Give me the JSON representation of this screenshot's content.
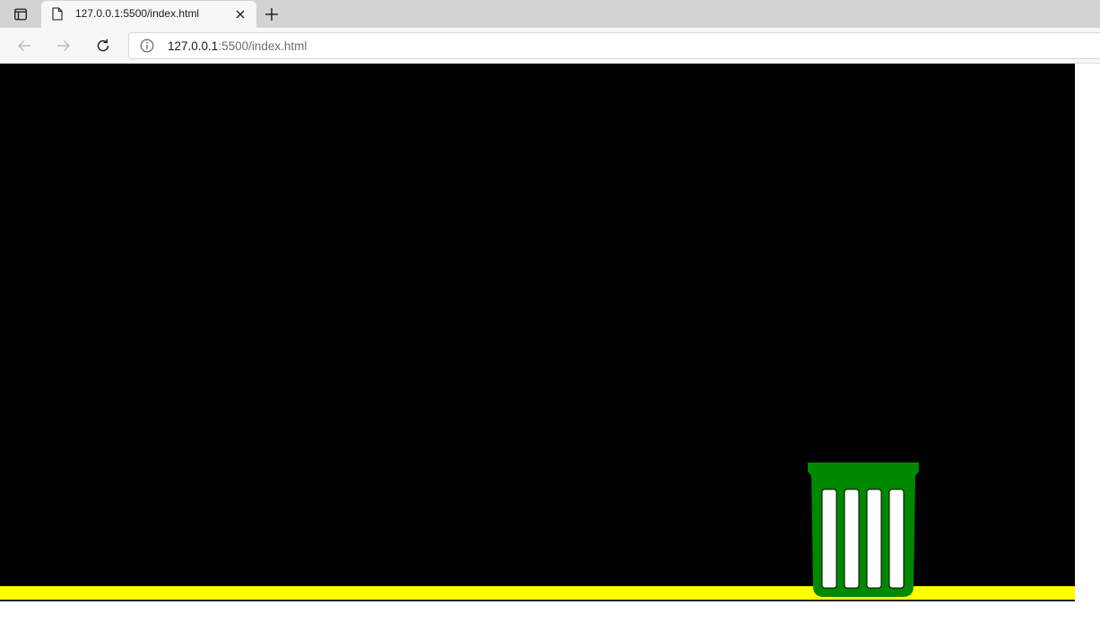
{
  "browser": {
    "tab": {
      "title": "127.0.0.1:5500/index.html"
    },
    "address": {
      "host": "127.0.0.1",
      "rest": ":5500/index.html"
    },
    "icons": {
      "tab_actions": "tab-actions-icon",
      "favicon": "page-icon",
      "close": "close-icon",
      "new_tab": "plus-icon",
      "back": "back-arrow-icon",
      "forward": "forward-arrow-icon",
      "refresh": "refresh-icon",
      "site_info": "info-icon"
    }
  },
  "game": {
    "background_color": "#000000",
    "ground_color": "#ffff00",
    "bin": {
      "icon": "trash-bin-icon",
      "body_color": "#008800",
      "slot_color": "#ffffff",
      "slots": 4
    }
  }
}
